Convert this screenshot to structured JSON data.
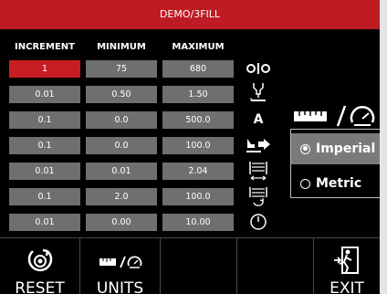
{
  "title": "DEMO/3FILL",
  "columns": {
    "increment": "INCREMENT",
    "minimum": "MINIMUM",
    "maximum": "MAXIMUM"
  },
  "rows": [
    {
      "increment": "1",
      "minimum": "75",
      "maximum": "680",
      "icon": "gap-icon"
    },
    {
      "increment": "0.01",
      "minimum": "0.50",
      "maximum": "1.50",
      "icon": "torch-height-icon"
    },
    {
      "increment": "0.1",
      "minimum": "0.0",
      "maximum": "500.0",
      "icon": "current-amps-icon"
    },
    {
      "increment": "0.1",
      "minimum": "0.0",
      "maximum": "100.0",
      "icon": "travel-speed-icon"
    },
    {
      "increment": "0.01",
      "minimum": "0.01",
      "maximum": "2.04",
      "icon": "weave-width-icon"
    },
    {
      "increment": "0.1",
      "minimum": "2.0",
      "maximum": "100.0",
      "icon": "weave-frequency-icon"
    },
    {
      "increment": "0.01",
      "minimum": "0.00",
      "maximum": "10.00",
      "icon": "dwell-time-icon"
    }
  ],
  "row_icon_letter": "A",
  "units_panel": {
    "icon": "ruler-gauge-icon",
    "options": [
      {
        "label": "Imperial",
        "selected": true
      },
      {
        "label": "Metric",
        "selected": false
      }
    ]
  },
  "bottom_bar": {
    "reset": {
      "label": "RESET",
      "icon": "reset-icon"
    },
    "units": {
      "label": "UNITS",
      "icon": "ruler-gauge-icon"
    },
    "exit": {
      "label": "EXIT",
      "icon": "exit-door-icon"
    }
  },
  "colors": {
    "title_bar": "#bf1b24",
    "active_cell": "#c71e25",
    "cell": "#6f6f6f",
    "background": "#000000"
  }
}
